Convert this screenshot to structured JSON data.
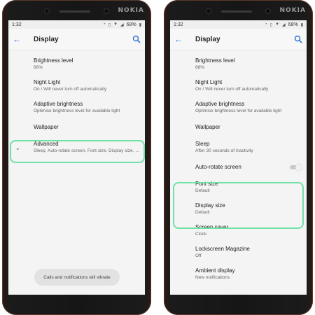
{
  "brand": "NOKIA",
  "colors": {
    "accent": "#2e72d2",
    "highlight": "#6fe0a6"
  },
  "left": {
    "status": {
      "time": "1:32",
      "battery": "68%"
    },
    "title": "Display",
    "items": [
      {
        "title": "Brightness level",
        "sub": "68%"
      },
      {
        "title": "Night Light",
        "sub": "On / Will never turn off automatically"
      },
      {
        "title": "Adaptive brightness",
        "sub": "Optimise brightness level for available light"
      },
      {
        "title": "Wallpaper"
      },
      {
        "title": "Advanced",
        "sub": "Sleep, Auto-rotate screen, Font size, Display size, S.."
      }
    ],
    "toast": "Calls and notifications will vibrate"
  },
  "right": {
    "status": {
      "time": "1:32",
      "battery": "68%"
    },
    "title": "Display",
    "items": [
      {
        "title": "Brightness level",
        "sub": "68%"
      },
      {
        "title": "Night Light",
        "sub": "On / Will never turn off automatically"
      },
      {
        "title": "Adaptive brightness",
        "sub": "Optimise brightness level for available light"
      },
      {
        "title": "Wallpaper"
      },
      {
        "title": "Sleep",
        "sub": "After 30 seconds of inactivity"
      },
      {
        "title": "Auto-rotate screen"
      },
      {
        "title": "Font size",
        "sub": "Default"
      },
      {
        "title": "Display size",
        "sub": "Default"
      },
      {
        "title": "Screen saver",
        "sub": "Clock"
      },
      {
        "title": "Lockscreen Magazine",
        "sub": "Off"
      },
      {
        "title": "Ambient display",
        "sub": "New notifications"
      }
    ]
  }
}
